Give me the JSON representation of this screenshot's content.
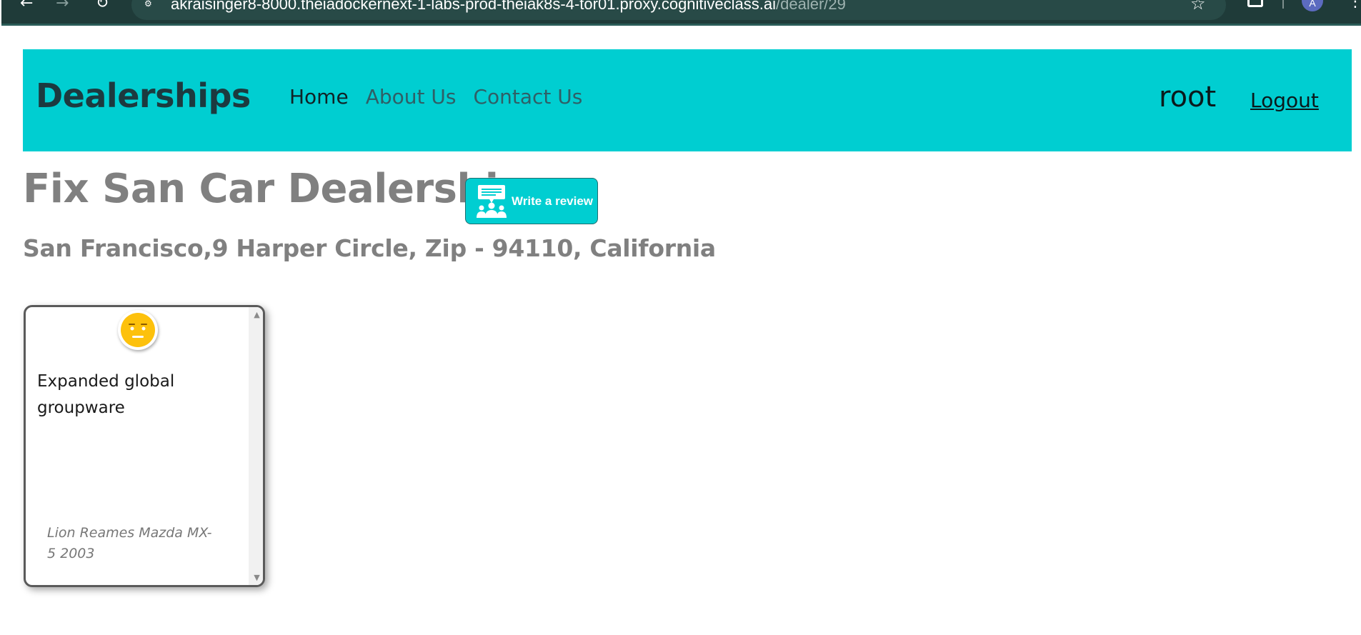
{
  "browser": {
    "url_host": "akraisinger8-8000.theiadockernext-1-labs-prod-theiak8s-4-tor01.proxy.cognitiveclass.ai",
    "url_path": "/dealer/29",
    "avatar_letter": "A"
  },
  "navbar": {
    "brand": "Dealerships",
    "links": [
      {
        "label": "Home",
        "active": true
      },
      {
        "label": "About Us",
        "active": false
      },
      {
        "label": "Contact Us",
        "active": false
      }
    ],
    "username": "root",
    "logout_label": "Logout",
    "background_color": "#00ced1"
  },
  "dealer": {
    "name": "Fix San Car Dealership",
    "address": "San Francisco,9 Harper Circle, Zip - 94110, California",
    "write_review_label": "Write a review"
  },
  "reviews": [
    {
      "sentiment": "neutral",
      "sentiment_icon": "neutral-face-icon",
      "text": "Expanded global groupware",
      "car": "Lion Reames Mazda MX-5 2003"
    }
  ]
}
